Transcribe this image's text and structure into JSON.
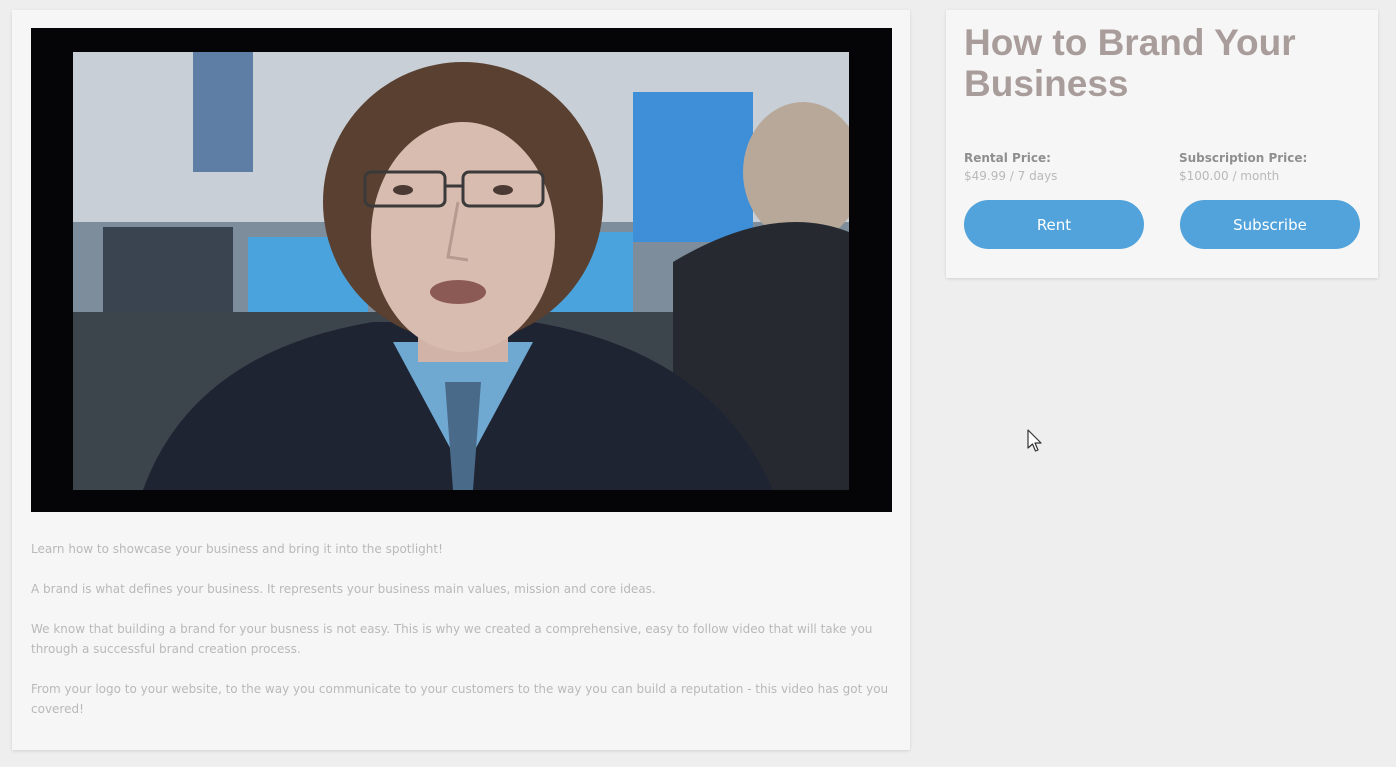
{
  "product": {
    "title": "How to Brand Your Business",
    "rental": {
      "label": "Rental Price:",
      "value": "$49.99 / 7 days"
    },
    "subscription": {
      "label": "Subscription Price:",
      "value": "$100.00 / month"
    },
    "rent_button": "Rent",
    "subscribe_button": "Subscribe"
  },
  "description": [
    "Learn how to showcase your business and bring it into the spotlight!",
    "A brand is what defines your business. It represents your business main values, mission and core ideas.",
    "We know that building a brand for your busness is not easy. This is why we created a comprehensive, easy to follow video that will take you through a successful brand creation process.",
    "From your logo to your website, to the way you communicate to your customers to the way you can build a reputation - this video has got you covered!"
  ],
  "colors": {
    "button": "#52a3db",
    "title": "#a99d9b"
  }
}
